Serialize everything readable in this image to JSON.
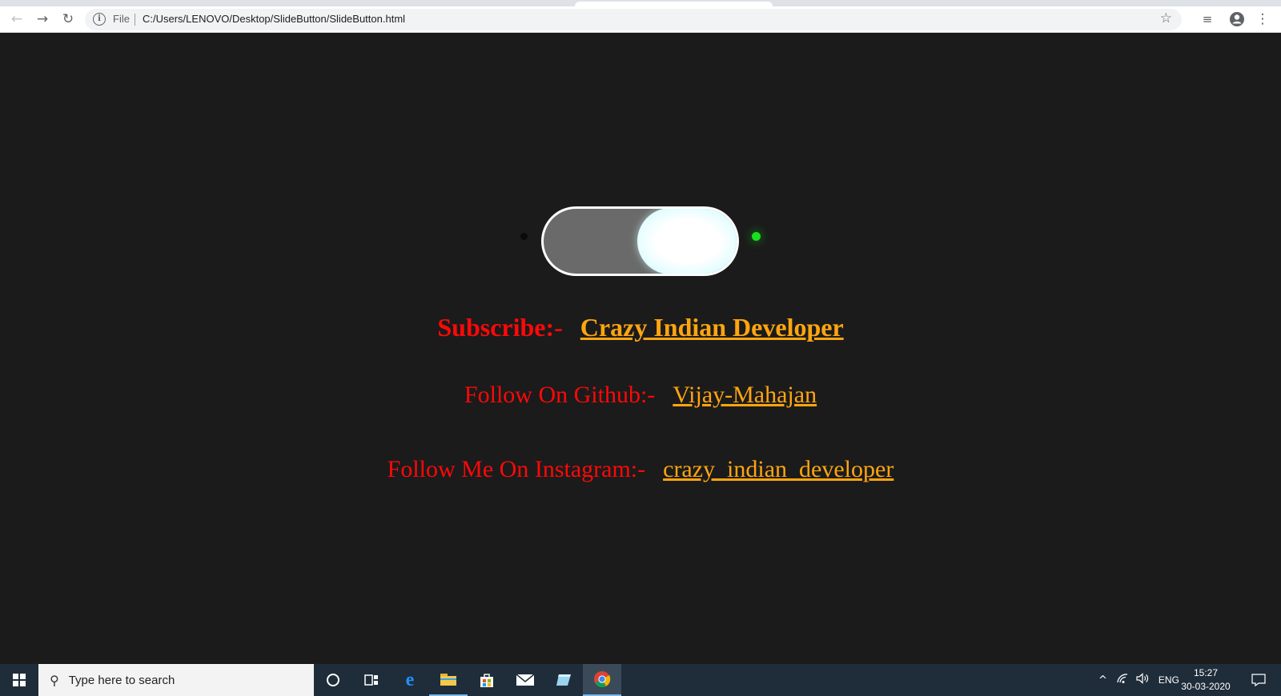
{
  "browser": {
    "back_icon": "arrow-left-icon",
    "forward_icon": "arrow-right-icon",
    "reload_icon": "reload-icon",
    "site_info_icon": "info-icon",
    "scheme_label": "File",
    "url": "C:/Users/LENOVO/Desktop/SlideButton/SlideButton.html",
    "bookmark_icon": "star-icon",
    "media_icon": "media-queue-icon",
    "profile_icon": "account-icon",
    "menu_icon": "kebab-menu-icon"
  },
  "page": {
    "background": "#1b1b1b",
    "toggle": {
      "state": "on",
      "track_color": "#6a6a6a",
      "knob_color": "#e4fdff",
      "border_color": "#ffffff"
    },
    "indicator_off_color": "#0a0a0a",
    "indicator_on_color": "#16e01c",
    "subscribe": {
      "label": "Subscribe:-",
      "link_text": "Crazy Indian Developer"
    },
    "github": {
      "label": "Follow On Github:-",
      "link_text": "Vijay-Mahajan"
    },
    "instagram": {
      "label": "Follow Me On Instagram:-",
      "link_text": "crazy_indian_developer"
    },
    "label_color": "#ff0808",
    "link_color": "#ffa510"
  },
  "taskbar": {
    "search_placeholder": "Type here to search",
    "apps": [
      "cortana-icon",
      "task-view-icon",
      "edge-icon",
      "file-explorer-icon",
      "store-icon",
      "mail-icon",
      "app-icon",
      "chrome-icon"
    ],
    "language": "ENG",
    "time": "15:27",
    "date": "30-03-2020"
  }
}
